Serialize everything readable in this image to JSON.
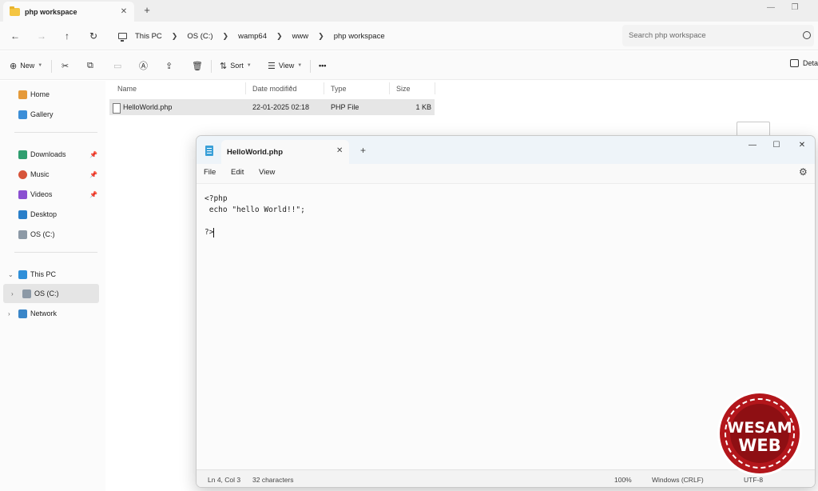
{
  "explorer": {
    "tab_title": "php workspace",
    "breadcrumbs": [
      "This PC",
      "OS (C:)",
      "wamp64",
      "www",
      "php workspace"
    ],
    "search_placeholder": "Search php workspace",
    "toolbar": {
      "new": "New",
      "sort": "Sort",
      "view": "View",
      "more": "•••",
      "details": "Deta"
    },
    "nav": {
      "home": "Home",
      "gallery": "Gallery",
      "downloads": "Downloads",
      "music": "Music",
      "videos": "Videos",
      "desktop": "Desktop",
      "osc": "OS (C:)",
      "thispc": "This PC",
      "osc_tree": "OS (C:)",
      "network": "Network"
    },
    "columns": {
      "name": "Name",
      "date": "Date modified",
      "type": "Type",
      "size": "Size"
    },
    "file": {
      "name": "HelloWorld.php",
      "date": "22-01-2025 02:18",
      "type": "PHP File",
      "size": "1 KB"
    }
  },
  "notepad": {
    "tab_title": "HelloWorld.php",
    "menu": {
      "file": "File",
      "edit": "Edit",
      "view": "View"
    },
    "code": {
      "line1": "<?php",
      "line2": " echo \"hello World!!\";",
      "line3": "",
      "line4": "?>"
    },
    "status": {
      "position": "Ln 4, Col 3",
      "chars": "32 characters",
      "zoom": "100%",
      "eol": "Windows (CRLF)",
      "encoding": "UTF-8"
    }
  },
  "logo": {
    "line1": "WESAM",
    "line2": "WEB"
  },
  "colors": {
    "accent": "#3aa0d8",
    "folder": "#f4c542",
    "logo_red": "#b3161b"
  }
}
